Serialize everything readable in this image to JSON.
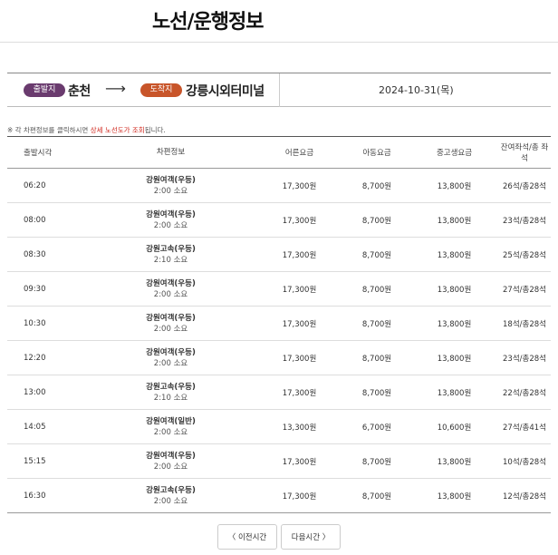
{
  "page": {
    "title": "노선/운행정보"
  },
  "route": {
    "departure_badge": "출발지",
    "departure_city": "춘천",
    "arrow": "⟶",
    "arrival_badge": "도착지",
    "arrival_city": "강릉시외터미널",
    "date": "2024-10-31(목)"
  },
  "notice": {
    "prefix": "※ 각 차편정보를 클릭하시면 ",
    "highlight": "상세 노선도가 조회",
    "suffix": "됩니다."
  },
  "table": {
    "headers": [
      "출발시각",
      "차편정보",
      "어른요금",
      "아동요금",
      "중고생요금",
      "잔여좌석/총 좌석"
    ],
    "rows": [
      {
        "time": "06:20",
        "grade": "강원여객(우등)",
        "duration": "2:00 소요",
        "adult": "17,300원",
        "child": "8,700원",
        "teen": "13,800원",
        "seats": "26석/총28석"
      },
      {
        "time": "08:00",
        "grade": "강원여객(우등)",
        "duration": "2:00 소요",
        "adult": "17,300원",
        "child": "8,700원",
        "teen": "13,800원",
        "seats": "23석/총28석"
      },
      {
        "time": "08:30",
        "grade": "강원고속(우등)",
        "duration": "2:10 소요",
        "adult": "17,300원",
        "child": "8,700원",
        "teen": "13,800원",
        "seats": "25석/총28석"
      },
      {
        "time": "09:30",
        "grade": "강원여객(우등)",
        "duration": "2:00 소요",
        "adult": "17,300원",
        "child": "8,700원",
        "teen": "13,800원",
        "seats": "27석/총28석"
      },
      {
        "time": "10:30",
        "grade": "강원여객(우등)",
        "duration": "2:00 소요",
        "adult": "17,300원",
        "child": "8,700원",
        "teen": "13,800원",
        "seats": "18석/총28석"
      },
      {
        "time": "12:20",
        "grade": "강원여객(우등)",
        "duration": "2:00 소요",
        "adult": "17,300원",
        "child": "8,700원",
        "teen": "13,800원",
        "seats": "23석/총28석"
      },
      {
        "time": "13:00",
        "grade": "강원고속(우등)",
        "duration": "2:10 소요",
        "adult": "17,300원",
        "child": "8,700원",
        "teen": "13,800원",
        "seats": "22석/총28석"
      },
      {
        "time": "14:05",
        "grade": "강원여객(일반)",
        "duration": "2:00 소요",
        "adult": "13,300원",
        "child": "6,700원",
        "teen": "10,600원",
        "seats": "27석/총41석"
      },
      {
        "time": "15:15",
        "grade": "강원여객(우등)",
        "duration": "2:00 소요",
        "adult": "17,300원",
        "child": "8,700원",
        "teen": "13,800원",
        "seats": "10석/총28석"
      },
      {
        "time": "16:30",
        "grade": "강원고속(우등)",
        "duration": "2:00 소요",
        "adult": "17,300원",
        "child": "8,700원",
        "teen": "13,800원",
        "seats": "12석/총28석"
      }
    ]
  },
  "pager": {
    "prev_label": "〈  이전시간",
    "next_label": "다음시간  〉"
  }
}
